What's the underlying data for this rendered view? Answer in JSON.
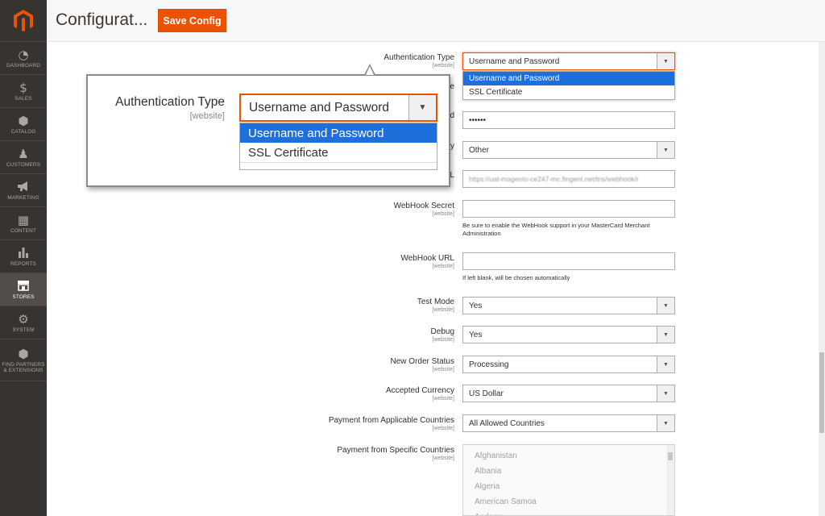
{
  "sidebar": {
    "items": [
      {
        "label": "DASHBOARD",
        "icon": "dashboard-icon",
        "glyph": "◔"
      },
      {
        "label": "SALES",
        "icon": "dollar-icon",
        "glyph": "$"
      },
      {
        "label": "CATALOG",
        "icon": "cube-icon",
        "glyph": "⬢"
      },
      {
        "label": "CUSTOMERS",
        "icon": "person-icon",
        "glyph": "♟"
      },
      {
        "label": "MARKETING",
        "icon": "megaphone-icon",
        "glyph": "📢"
      },
      {
        "label": "CONTENT",
        "icon": "layout-icon",
        "glyph": "▦"
      },
      {
        "label": "REPORTS",
        "icon": "bar-chart-icon",
        "glyph": "▮"
      },
      {
        "label": "STORES",
        "icon": "store-icon",
        "glyph": "⌂"
      },
      {
        "label": "SYSTEM",
        "icon": "gear-icon",
        "glyph": "⚙"
      },
      {
        "label": "FIND PARTNERS & EXTENSIONS",
        "icon": "box-icon",
        "glyph": "⬢"
      }
    ]
  },
  "header": {
    "title": "Configurat...",
    "save_label": "Save Config"
  },
  "form": {
    "auth_type": {
      "label": "Authentication Type",
      "scope": "[website]",
      "value": "Username and Password",
      "options": [
        "Username and Password",
        "SSL Certificate"
      ]
    },
    "hidden_row_1": {
      "label_fragment": "e"
    },
    "hidden_row_2": {
      "label_fragment": "d",
      "value": "••••••"
    },
    "hidden_row_3": {
      "label_fragment": "y",
      "value": "Other"
    },
    "hidden_row_4": {
      "label_fragment": "L",
      "value": "https://uat-magento-ce247-mc.fingent.net/tns/webhook/r"
    },
    "webhook_secret": {
      "label": "WebHook Secret",
      "scope": "[website]",
      "value": "",
      "note": "Be sure to enable the WebHook support in your MasterCard Merchant Administration"
    },
    "webhook_url": {
      "label": "WebHook URL",
      "scope": "[website]",
      "value": "",
      "note": "If left blank, will be chosen automatically"
    },
    "test_mode": {
      "label": "Test Mode",
      "scope": "[website]",
      "value": "Yes"
    },
    "debug": {
      "label": "Debug",
      "scope": "[website]",
      "value": "Yes"
    },
    "new_order_status": {
      "label": "New Order Status",
      "scope": "[website]",
      "value": "Processing"
    },
    "accepted_currency": {
      "label": "Accepted Currency",
      "scope": "[website]",
      "value": "US Dollar"
    },
    "applicable_countries": {
      "label": "Payment from Applicable Countries",
      "scope": "[website]",
      "value": "All Allowed Countries"
    },
    "specific_countries": {
      "label": "Payment from Specific Countries",
      "scope": "[website]",
      "options": [
        "Afghanistan",
        "Albania",
        "Algeria",
        "American Samoa",
        "Andorra"
      ]
    }
  },
  "callout": {
    "label": "Authentication Type",
    "scope": "[website]",
    "value": "Username and Password",
    "options": [
      "Username and Password",
      "SSL Certificate"
    ]
  },
  "colors": {
    "accent": "#eb5202",
    "selected": "#1e6fd9",
    "sidebar": "#373330"
  }
}
